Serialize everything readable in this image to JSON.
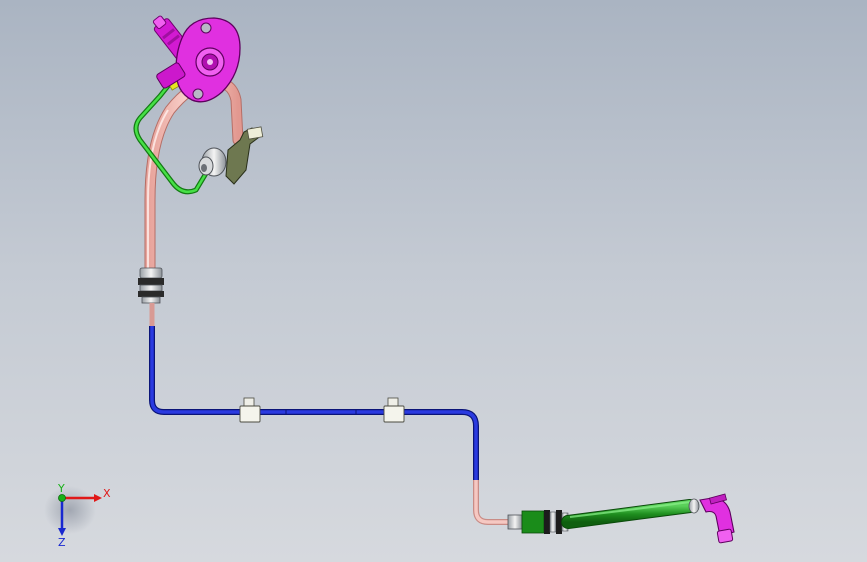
{
  "viewport": {
    "background_top": "#aab4c2",
    "background_bottom": "#d6d9de"
  },
  "model": {
    "parts": [
      {
        "name": "pressure-sensor",
        "color": "#e020e0"
      },
      {
        "name": "rigid-tube",
        "color": "#f0b4ae"
      },
      {
        "name": "hose-assembly",
        "color": "#1e2ecc"
      },
      {
        "name": "bypass-line",
        "color": "#2ec82e"
      },
      {
        "name": "flexible-hose",
        "color": "#1f8f1f"
      },
      {
        "name": "mounting-bracket",
        "color": "#6f7a52"
      }
    ]
  },
  "triad": {
    "x_label": "X",
    "y_label": "Y",
    "z_label": "Z",
    "x_color": "#e01818",
    "y_color": "#18b018",
    "z_color": "#1828d0"
  }
}
